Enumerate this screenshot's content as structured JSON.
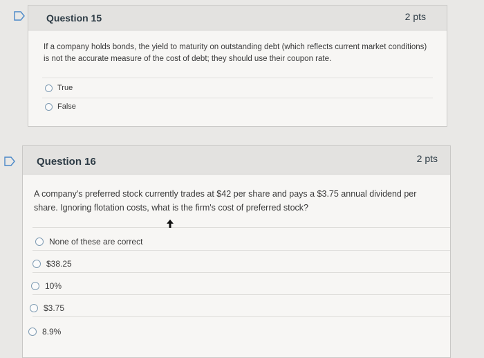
{
  "question15": {
    "title": "Question 15",
    "points": "2 pts",
    "text": "If a company holds bonds, the yield to maturity on outstanding debt (which reflects current market conditions) is not the accurate measure of the cost of debt; they should use their coupon rate.",
    "options": [
      "True",
      "False"
    ]
  },
  "question16": {
    "title": "Question 16",
    "points": "2 pts",
    "text": "A company's preferred stock currently trades at $42 per share and pays a $3.75 annual dividend per share. Ignoring flotation costs, what is the firm's cost of preferred stock?",
    "options": [
      "None of these are correct",
      "$38.25",
      "10%",
      "$3.75",
      "8.9%"
    ]
  },
  "colors": {
    "page_background": "#e9e8e6",
    "card_background": "#f7f6f4",
    "header_background": "#e3e2e0",
    "radio_border": "#7f9cb3",
    "flag_outline": "#4a88c8"
  },
  "icons": {
    "flag": "flag-outline-icon",
    "cursor": "mouse-pointer-icon"
  }
}
